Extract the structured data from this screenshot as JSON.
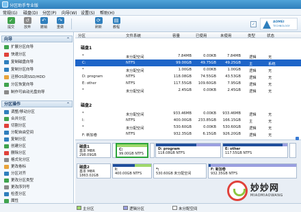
{
  "window": {
    "title": "分区助手专业版"
  },
  "menu": [
    "常规(G)",
    "磁盘(D)",
    "分区(P)",
    "向导(W)",
    "设置(S)",
    "帮助(H)"
  ],
  "toolbar": {
    "buttons": [
      {
        "label": "提交",
        "icon": "check-icon",
        "color": "#3fa34d"
      },
      {
        "label": "放弃",
        "icon": "discard-icon",
        "color": "#8a8a8a"
      },
      {
        "label": "撤销",
        "icon": "undo-icon",
        "color": "#2f7fbd"
      },
      {
        "label": "重做",
        "icon": "redo-icon",
        "color": "#2f7fbd"
      },
      {
        "label": "刷新",
        "icon": "refresh-icon",
        "color": "#2f7fbd"
      },
      {
        "label": "教程",
        "icon": "tutorial-icon",
        "color": "#2f7fbd"
      }
    ],
    "brand_line1": "AOMEI",
    "brand_line2": "TECHNOLOGY"
  },
  "sidebar": {
    "wizard_title": "向导",
    "wizard_items": [
      "扩展分区向导",
      "快速分区",
      "复制磁盘向导",
      "复制分区向导",
      "迁移OS到SSD/HDD",
      "分区恢复向导",
      "制作可启动光盘向导"
    ],
    "ops_title": "分区操作",
    "ops_items": [
      "调整/移动分区",
      "合并分区",
      "切割分区",
      "分配自由空间",
      "复制分区",
      "创建分区",
      "删除分区",
      "格式化分区",
      "更改卷标",
      "分区对齐",
      "更改分区类型",
      "更改序列号",
      "检查分区",
      "属性"
    ]
  },
  "table": {
    "headers": [
      "分区",
      "文件系统",
      "容量",
      "已使用",
      "未使用",
      "类型",
      "状态"
    ],
    "disk1_label": "磁盘1",
    "disk2_label": "磁盘2",
    "disk1_rows": [
      [
        "*",
        "未分配空间",
        "7.84MB",
        "0.00KB",
        "7.84MB",
        "逻辑",
        "无"
      ],
      [
        "C:",
        "NTFS",
        "99.00GB",
        "49.75GB",
        "49.25GB",
        "主",
        "系统"
      ],
      [
        "*",
        "未分配空间",
        "1.00GB",
        "0.00KB",
        "1.00GB",
        "逻辑",
        "无"
      ],
      [
        "D: program",
        "NTFS",
        "118.08GB",
        "74.55GB",
        "43.53GB",
        "逻辑",
        "无"
      ],
      [
        "E: other",
        "NTFS",
        "117.55GB",
        "109.60GB",
        "7.95GB",
        "逻辑",
        "无"
      ],
      [
        "*",
        "未分配空间",
        "2.45GB",
        "0.00KB",
        "2.45GB",
        "逻辑",
        "无"
      ]
    ],
    "disk2_rows": [
      [
        "*",
        "未分配空间",
        "933.46MB",
        "0.00KB",
        "933.46MB",
        "逻辑",
        "无"
      ],
      [
        "I:",
        "NTFS",
        "400.00GB",
        "233.85GB",
        "166.15GB",
        "主",
        "无"
      ],
      [
        "*",
        "未分配空间",
        "530.60GB",
        "0.00KB",
        "530.60GB",
        "逻辑",
        "无"
      ],
      [
        "F: 新加卷",
        "NTFS",
        "932.35GB",
        "6.15GB",
        "926.20GB",
        "逻辑",
        "无"
      ]
    ]
  },
  "diskmap": {
    "disk1": {
      "name": "磁盘1",
      "type": "基本 MBR",
      "size": "298.09GB"
    },
    "disk2": {
      "name": "磁盘2",
      "type": "基本 MBR",
      "size": "1863.02GB"
    },
    "disk1_parts": [
      {
        "label": "*",
        "size": "",
        "used": 0
      },
      {
        "label": "C:",
        "size": "99.00GB NTFS",
        "used": 0.5
      },
      {
        "label": "*",
        "size": "",
        "used": 0
      },
      {
        "label": "D: program",
        "size": "118.08GB NTFS",
        "used": 0.63
      },
      {
        "label": "E: other",
        "size": "117.55GB NTFS",
        "used": 0.93
      },
      {
        "label": "*",
        "size": "",
        "used": 0
      }
    ],
    "disk2_parts": [
      {
        "label": "I:",
        "size": "400.00GB NTFS",
        "used": 0.58
      },
      {
        "label": "*:",
        "size": "530.60GB 未分配空间",
        "used": 0
      },
      {
        "label": "F: 新加卷",
        "size": "932.35GB NTFS",
        "used": 0.01
      }
    ]
  },
  "legend": [
    "主分区",
    "逻辑分区",
    "未分配空间"
  ],
  "legend_colors": [
    "#9fd86b",
    "#9a9fe0",
    "#ffffff"
  ],
  "watermark": {
    "title": "妙妙网",
    "subtitle": "MIAOMIAOWANG"
  }
}
